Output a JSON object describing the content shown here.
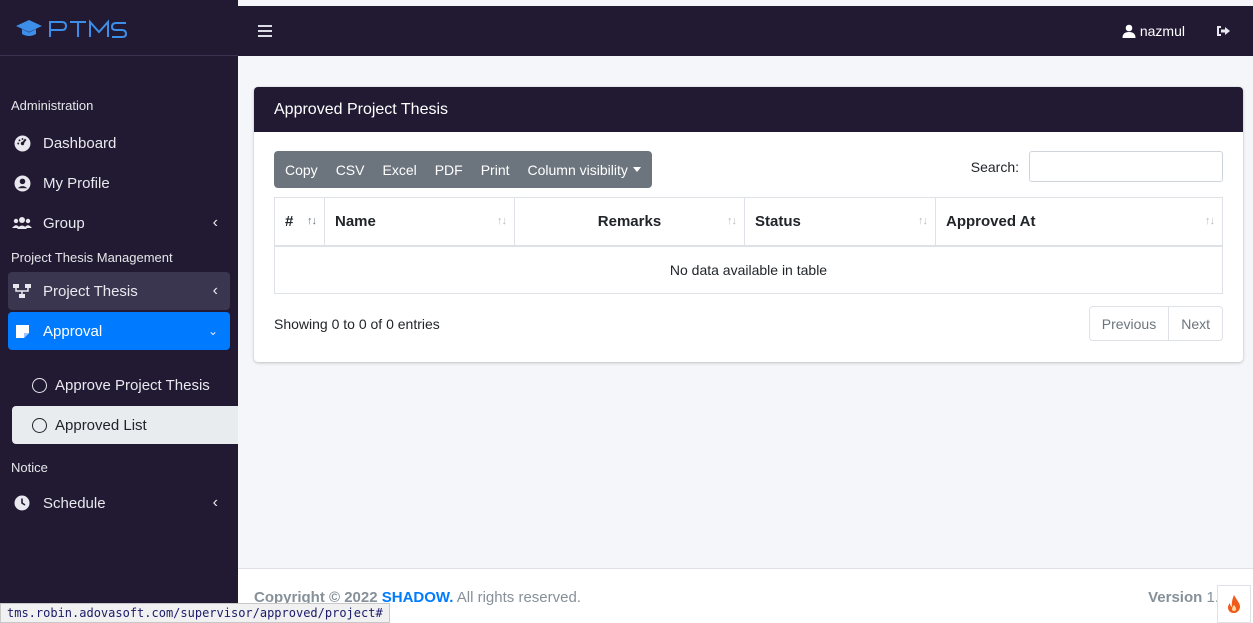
{
  "brand": {
    "logo_text": "PTMS"
  },
  "sidebar": {
    "sections": [
      {
        "label": "Administration"
      },
      {
        "label": "Project Thesis Management"
      },
      {
        "label": "Notice"
      }
    ],
    "items": [
      {
        "label": "Dashboard",
        "icon": "dashboard-icon"
      },
      {
        "label": "My Profile",
        "icon": "user-circle-icon"
      },
      {
        "label": "Group",
        "icon": "users-icon"
      },
      {
        "label": "Project Thesis",
        "icon": "sitemap-icon"
      },
      {
        "label": "Approval",
        "icon": "sticky-note-icon"
      },
      {
        "label": "Schedule",
        "icon": "clock-icon"
      }
    ],
    "subitems": [
      {
        "label": "Approve Project Thesis"
      },
      {
        "label": "Approved List"
      }
    ]
  },
  "topbar": {
    "username": "nazmul"
  },
  "card": {
    "title": "Approved Project Thesis",
    "buttons": [
      "Copy",
      "CSV",
      "Excel",
      "PDF",
      "Print",
      "Column visibility"
    ],
    "search_label": "Search:",
    "search_value": "",
    "columns": [
      "#",
      "Name",
      "Remarks",
      "Status",
      "Approved At"
    ],
    "empty_message": "No data available in table",
    "info": "Showing 0 to 0 of 0 entries",
    "pagination": {
      "previous": "Previous",
      "next": "Next"
    }
  },
  "footer": {
    "copyright_prefix": "Copyright © 2022 ",
    "brand": "SHADOW.",
    "rights": " All rights reserved.",
    "version_label": "Version",
    "version_value": "1."
  },
  "statusbar": {
    "url": "tms.robin.adovasoft.com/supervisor/approved/project#"
  },
  "colors": {
    "sidebar_bg": "#221a33",
    "accent": "#007bff",
    "button_gray": "#6c757d"
  }
}
